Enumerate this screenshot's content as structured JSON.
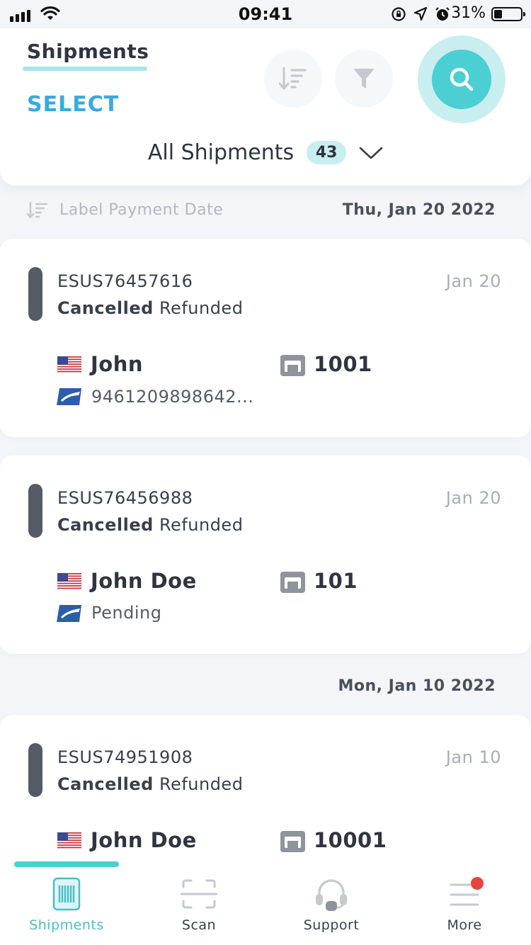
{
  "status_bar": {
    "time": "09:41",
    "battery_percent": "31%",
    "battery_level": 0.31,
    "icons": [
      "signal-icon",
      "wifi-icon",
      "rotation-lock-icon",
      "location-icon",
      "alarm-icon",
      "battery-icon"
    ]
  },
  "header": {
    "tab_title": "Shipments",
    "select_label": "SELECT",
    "filter_label": "All Shipments",
    "count": "43",
    "accent": "#4ccfd3",
    "select_color": "#3aa9e0"
  },
  "sort": {
    "label": "Label Payment Date"
  },
  "groups": [
    {
      "date": "Thu, Jan 20 2022"
    },
    {
      "date": "Mon, Jan 10 2022"
    }
  ],
  "shipments": [
    {
      "id": "ESUS76457616",
      "status": "Cancelled",
      "payment": "Refunded",
      "date": "Jan 20",
      "recipient": "John",
      "store": "1001",
      "tracking": "9461209898642..."
    },
    {
      "id": "ESUS76456988",
      "status": "Cancelled",
      "payment": "Refunded",
      "date": "Jan 20",
      "recipient": "John Doe",
      "store": "101",
      "tracking": "Pending"
    },
    {
      "id": "ESUS74951908",
      "status": "Cancelled",
      "payment": "Refunded",
      "date": "Jan 10",
      "recipient": "John Doe",
      "store": "10001"
    }
  ],
  "tabbar": {
    "items": [
      {
        "label": "Shipments",
        "icon": "barcode-icon",
        "active": true
      },
      {
        "label": "Scan",
        "icon": "scan-icon"
      },
      {
        "label": "Support",
        "icon": "headset-icon"
      },
      {
        "label": "More",
        "icon": "menu-icon",
        "has_notification": true
      }
    ]
  }
}
